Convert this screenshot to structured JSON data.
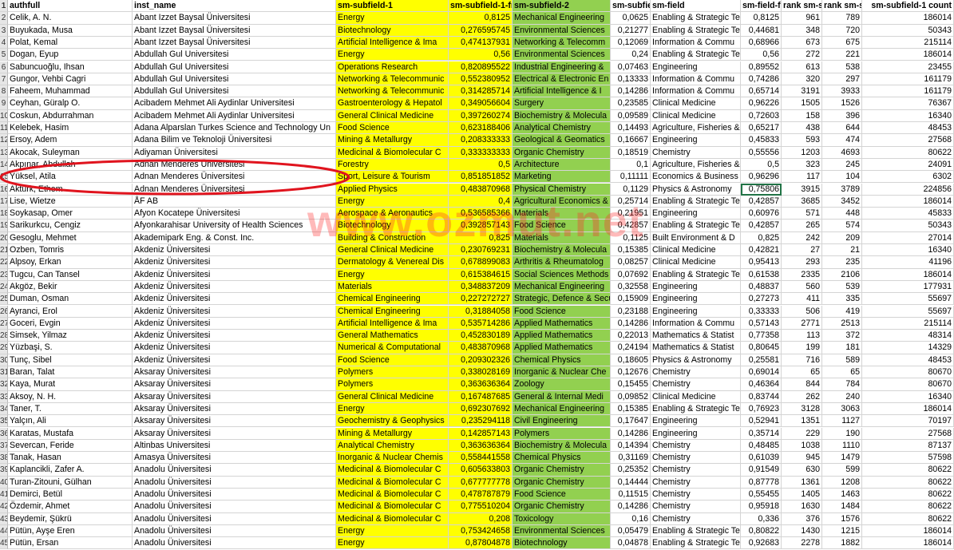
{
  "colors": {
    "yellow_column": "#ffff00",
    "green_column": "#92d050",
    "annotation": "#e0141e",
    "selected_border": "#217346"
  },
  "watermark": "www.ozmut.net",
  "headers": [
    "authfull",
    "inst_name",
    "sm-subfield-1",
    "sm-subfield-1-fr",
    "sm-subfield-2",
    "sm-subfie",
    "sm-field",
    "sm-field-f",
    "rank sm-s",
    "rank sm-s",
    "sm-subfield-1 count"
  ],
  "header_row_number": "1",
  "selected_cell": {
    "row": 14,
    "col": 8
  },
  "rows": [
    [
      "2",
      "Celik, A. N.",
      "Abant Izzet Baysal Üniversitesi",
      "Energy",
      "0,8125",
      "Mechanical Engineering",
      "0,0625",
      "Enabling & Strategic Te",
      "0,8125",
      "961",
      "789",
      "186014"
    ],
    [
      "3",
      "Buyukada, Musa",
      "Abant Izzet Baysal Üniversitesi",
      "Biotechnology",
      "0,276595745",
      "Environmental Sciences",
      "0,21277",
      "Enabling & Strategic Te",
      "0,44681",
      "348",
      "720",
      "50343"
    ],
    [
      "4",
      "Polat, Kemal",
      "Abant Izzet Baysal Üniversitesi",
      "Artificial Intelligence & Ima",
      "0,474137931",
      "Networking & Telecomm",
      "0,12069",
      "Information & Commu",
      "0,68966",
      "673",
      "675",
      "215114"
    ],
    [
      "5",
      "Dogan, Eyup",
      "Abdullah Gul Universitesi",
      "Energy",
      "0,56",
      "Environmental Sciences",
      "0,24",
      "Enabling & Strategic Te",
      "0,56",
      "272",
      "221",
      "186014"
    ],
    [
      "6",
      "Sabuncuoğlu, Ihsan",
      "Abdullah Gul Universitesi",
      "Operations Research",
      "0,820895522",
      "Industrial Engineering &",
      "0,07463",
      "Engineering",
      "0,89552",
      "613",
      "538",
      "23455"
    ],
    [
      "7",
      "Gungor, Vehbi Cagri",
      "Abdullah Gul Universitesi",
      "Networking & Telecommunic",
      "0,552380952",
      "Electrical & Electronic En",
      "0,13333",
      "Information & Commu",
      "0,74286",
      "320",
      "297",
      "161179"
    ],
    [
      "8",
      "Faheem, Muhammad",
      "Abdullah Gul Universitesi",
      "Networking & Telecommunic",
      "0,314285714",
      "Artificial Intelligence & I",
      "0,14286",
      "Information & Commu",
      "0,65714",
      "3191",
      "3933",
      "161179"
    ],
    [
      "9",
      "Ceyhan, Güralp O.",
      "Acibadem Mehmet Ali Aydinlar Universitesi",
      "Gastroenterology & Hepatol",
      "0,349056604",
      "Surgery",
      "0,23585",
      "Clinical Medicine",
      "0,96226",
      "1505",
      "1526",
      "76367"
    ],
    [
      "10",
      "Coskun, Abdurrahman",
      "Acibadem Mehmet Ali Aydinlar Universitesi",
      "General Clinical Medicine",
      "0,397260274",
      "Biochemistry & Molecula",
      "0,09589",
      "Clinical Medicine",
      "0,72603",
      "158",
      "396",
      "16340"
    ],
    [
      "11",
      "Kelebek, Hasim",
      "Adana Alparslan Turkes Science and Technology Un",
      "Food Science",
      "0,623188406",
      "Analytical Chemistry",
      "0,14493",
      "Agriculture, Fisheries &",
      "0,65217",
      "438",
      "644",
      "48453"
    ],
    [
      "12",
      "Ersoy, Adem",
      "Adana Bilim ve Teknoloji Üniversitesi",
      "Mining & Metallurgy",
      "0,208333333",
      "Geological & Geomatics",
      "0,16667",
      "Engineering",
      "0,45833",
      "593",
      "474",
      "27568"
    ],
    [
      "13",
      "Akocak, Suleyman",
      "Adiyaman Üniversitesi",
      "Medicinal & Biomolecular C",
      "0,333333333",
      "Organic Chemistry",
      "0,18519",
      "Chemistry",
      "0,55556",
      "1203",
      "4693",
      "80622"
    ],
    [
      "14",
      "Akpınar, Abdullah",
      "Adnan Menderes Üniversitesi",
      "Forestry",
      "0,5",
      "Architecture",
      "0,1",
      "Agriculture, Fisheries &",
      "0,5",
      "323",
      "245",
      "24091"
    ],
    [
      "15",
      "Yüksel, Atila",
      "Adnan Menderes Üniversitesi",
      "Sport, Leisure & Tourism",
      "0,851851852",
      "Marketing",
      "0,11111",
      "Economics & Business",
      "0,96296",
      "117",
      "104",
      "6302"
    ],
    [
      "16",
      "Aktürk, Ethem",
      "Adnan Menderes Üniversitesi",
      "Applied Physics",
      "0,483870968",
      "Physical Chemistry",
      "0,1129",
      "Physics & Astronomy",
      "0,75806",
      "3915",
      "3789",
      "224856"
    ],
    [
      "17",
      "Lise, Wietze",
      "ÅF AB",
      "Energy",
      "0,4",
      "Agricultural Economics &",
      "0,25714",
      "Enabling & Strategic Te",
      "0,42857",
      "3685",
      "3452",
      "186014"
    ],
    [
      "18",
      "Soykasap, Omer",
      "Afyon Kocatepe Üniversitesi",
      "Aerospace & Aeronautics",
      "0,536585366",
      "Materials",
      "0,21951",
      "Engineering",
      "0,60976",
      "571",
      "448",
      "45833"
    ],
    [
      "19",
      "Sarikurkcu, Cengiz",
      "Afyonkarahisar University of Health Sciences",
      "Biotechnology",
      "0,392857143",
      "Food Science",
      "0,42857",
      "Enabling & Strategic Te",
      "0,42857",
      "265",
      "574",
      "50343"
    ],
    [
      "20",
      "Gesoglu, Mehmet",
      "Akademipark Eng. & Const. Inc.",
      "Building & Construction",
      "0,825",
      "Materials",
      "0,1125",
      "Built Environment & D",
      "0,825",
      "242",
      "209",
      "27014"
    ],
    [
      "21",
      "Ozben, Tomris",
      "Akdeniz Üniversitesi",
      "General Clinical Medicine",
      "0,230769231",
      "Biochemistry & Molecula",
      "0,15385",
      "Clinical Medicine",
      "0,42821",
      "27",
      "21",
      "16340"
    ],
    [
      "22",
      "Alpsoy, Erkan",
      "Akdeniz Üniversitesi",
      "Dermatology & Venereal Dis",
      "0,678899083",
      "Arthritis & Rheumatolog",
      "0,08257",
      "Clinical Medicine",
      "0,95413",
      "293",
      "235",
      "41196"
    ],
    [
      "23",
      "Tugcu, Can Tansel",
      "Akdeniz Üniversitesi",
      "Energy",
      "0,615384615",
      "Social Sciences Methods",
      "0,07692",
      "Enabling & Strategic Te",
      "0,61538",
      "2335",
      "2106",
      "186014"
    ],
    [
      "24",
      "Akgöz, Bekir",
      "Akdeniz Üniversitesi",
      "Materials",
      "0,348837209",
      "Mechanical Engineering",
      "0,32558",
      "Engineering",
      "0,48837",
      "560",
      "539",
      "177931"
    ],
    [
      "25",
      "Duman, Osman",
      "Akdeniz Üniversitesi",
      "Chemical Engineering",
      "0,227272727",
      "Strategic, Defence & Secu",
      "0,15909",
      "Engineering",
      "0,27273",
      "411",
      "335",
      "55697"
    ],
    [
      "26",
      "Ayranci, Erol",
      "Akdeniz Üniversitesi",
      "Chemical Engineering",
      "0,31884058",
      "Food Science",
      "0,23188",
      "Engineering",
      "0,33333",
      "506",
      "419",
      "55697"
    ],
    [
      "27",
      "Goceri, Evgin",
      "Akdeniz Üniversitesi",
      "Artificial Intelligence & Ima",
      "0,535714286",
      "Applied Mathematics",
      "0,14286",
      "Information & Commu",
      "0,57143",
      "2771",
      "2513",
      "215114"
    ],
    [
      "28",
      "Simsek, Yilmaz",
      "Akdeniz Üniversitesi",
      "General Mathematics",
      "0,452830189",
      "Applied Mathematics",
      "0,22013",
      "Mathematics & Statist",
      "0,77358",
      "113",
      "372",
      "48314"
    ],
    [
      "29",
      "Yüzbaşi, S.",
      "Akdeniz Üniversitesi",
      "Numerical & Computational",
      "0,483870968",
      "Applied Mathematics",
      "0,24194",
      "Mathematics & Statist",
      "0,80645",
      "199",
      "181",
      "14329"
    ],
    [
      "30",
      "Tunç, Sibel",
      "Akdeniz Üniversitesi",
      "Food Science",
      "0,209302326",
      "Chemical Physics",
      "0,18605",
      "Physics & Astronomy",
      "0,25581",
      "716",
      "589",
      "48453"
    ],
    [
      "31",
      "Baran, Talat",
      "Aksaray Üniversitesi",
      "Polymers",
      "0,338028169",
      "Inorganic & Nuclear Che",
      "0,12676",
      "Chemistry",
      "0,69014",
      "65",
      "65",
      "80670"
    ],
    [
      "32",
      "Kaya, Murat",
      "Aksaray Üniversitesi",
      "Polymers",
      "0,363636364",
      "Zoology",
      "0,15455",
      "Chemistry",
      "0,46364",
      "844",
      "784",
      "80670"
    ],
    [
      "33",
      "Aksoy, N. H.",
      "Aksaray Üniversitesi",
      "General Clinical Medicine",
      "0,167487685",
      "General & Internal Medi",
      "0,09852",
      "Clinical Medicine",
      "0,83744",
      "262",
      "240",
      "16340"
    ],
    [
      "34",
      "Taner, T.",
      "Aksaray Üniversitesi",
      "Energy",
      "0,692307692",
      "Mechanical Engineering",
      "0,15385",
      "Enabling & Strategic Te",
      "0,76923",
      "3128",
      "3063",
      "186014"
    ],
    [
      "35",
      "Yalçın, Ali",
      "Aksaray Üniversitesi",
      "Geochemistry & Geophysics",
      "0,235294118",
      "Civil Engineering",
      "0,17647",
      "Engineering",
      "0,52941",
      "1351",
      "1127",
      "70197"
    ],
    [
      "36",
      "Karatas, Mustafa",
      "Aksaray Üniversitesi",
      "Mining & Metallurgy",
      "0,142857143",
      "Polymers",
      "0,14286",
      "Engineering",
      "0,35714",
      "229",
      "190",
      "27568"
    ],
    [
      "37",
      "Severcan, Feride",
      "Altinbas Universitesi",
      "Analytical Chemistry",
      "0,363636364",
      "Biochemistry & Molecula",
      "0,14394",
      "Chemistry",
      "0,48485",
      "1038",
      "1110",
      "87137"
    ],
    [
      "38",
      "Tanak, Hasan",
      "Amasya Üniversitesi",
      "Inorganic & Nuclear Chemis",
      "0,558441558",
      "Chemical Physics",
      "0,31169",
      "Chemistry",
      "0,61039",
      "945",
      "1479",
      "57598"
    ],
    [
      "39",
      "Kaplancikli, Zafer A.",
      "Anadolu Üniversitesi",
      "Medicinal & Biomolecular C",
      "0,605633803",
      "Organic Chemistry",
      "0,25352",
      "Chemistry",
      "0,91549",
      "630",
      "599",
      "80622"
    ],
    [
      "40",
      "Turan-Zitouni, Gülhan",
      "Anadolu Üniversitesi",
      "Medicinal & Biomolecular C",
      "0,677777778",
      "Organic Chemistry",
      "0,14444",
      "Chemistry",
      "0,87778",
      "1361",
      "1208",
      "80622"
    ],
    [
      "41",
      "Demirci, Betül",
      "Anadolu Üniversitesi",
      "Medicinal & Biomolecular C",
      "0,478787879",
      "Food Science",
      "0,11515",
      "Chemistry",
      "0,55455",
      "1405",
      "1463",
      "80622"
    ],
    [
      "42",
      "Özdemir, Ahmet",
      "Anadolu Üniversitesi",
      "Medicinal & Biomolecular C",
      "0,775510204",
      "Organic Chemistry",
      "0,14286",
      "Chemistry",
      "0,95918",
      "1630",
      "1484",
      "80622"
    ],
    [
      "43",
      "Beydemir, Şükrü",
      "Anadolu Üniversitesi",
      "Medicinal & Biomolecular C",
      "0,208",
      "Toxicology",
      "0,16",
      "Chemistry",
      "0,336",
      "376",
      "1576",
      "80622"
    ],
    [
      "44",
      "Pütün, Ayşe Eren",
      "Anadolu Üniversitesi",
      "Energy",
      "0,753424658",
      "Environmental Sciences",
      "0,05479",
      "Enabling & Strategic Te",
      "0,80822",
      "1430",
      "1215",
      "186014"
    ],
    [
      "45",
      "Pütün, Ersan",
      "Anadolu Üniversitesi",
      "Energy",
      "0,87804878",
      "Biotechnology",
      "0,04878",
      "Enabling & Strategic Te",
      "0,92683",
      "2278",
      "1882",
      "186014"
    ]
  ]
}
